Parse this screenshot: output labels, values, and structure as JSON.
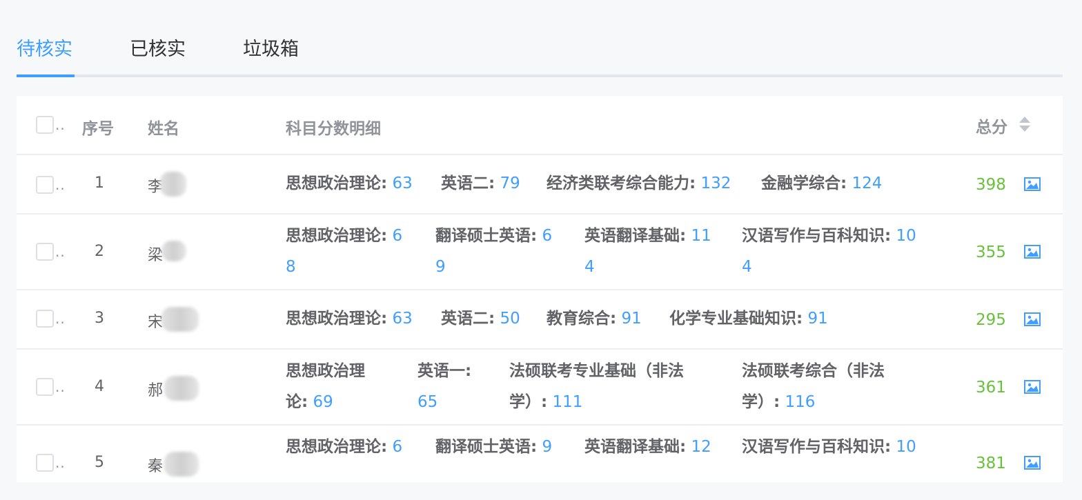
{
  "tabs": [
    {
      "label": "待核实",
      "active": true
    },
    {
      "label": "已核实",
      "active": false
    },
    {
      "label": "垃圾箱",
      "active": false
    }
  ],
  "table": {
    "headers": {
      "select_ellipsis": "..",
      "seq": "序号",
      "name": "姓名",
      "subjects": "科目分数明细",
      "total": "总分"
    },
    "rows": [
      {
        "seq": "1",
        "name": "李",
        "total": "398",
        "subjects": [
          {
            "label": "思想政治理论:",
            "score": "63"
          },
          {
            "label": "英语二:",
            "score": "79"
          },
          {
            "label": "经济类联考综合能力:",
            "score": "132"
          },
          {
            "label": "金融学综合:",
            "score": "124"
          }
        ]
      },
      {
        "seq": "2",
        "name": "梁",
        "total": "355",
        "subjects": [
          {
            "label": "思想政治理论:",
            "score": "6",
            "score_wrap": "8"
          },
          {
            "label": "翻译硕士英语:",
            "score": "6",
            "score_wrap": "9"
          },
          {
            "label": "英语翻译基础:",
            "score": "11",
            "score_wrap": "4"
          },
          {
            "label": "汉语写作与百科知识:",
            "score": "10",
            "score_wrap": "4"
          }
        ]
      },
      {
        "seq": "3",
        "name": "宋",
        "total": "295",
        "subjects": [
          {
            "label": "思想政治理论:",
            "score": "63"
          },
          {
            "label": "英语二:",
            "score": "50"
          },
          {
            "label": "教育综合:",
            "score": "91"
          },
          {
            "label": "化学专业基础知识:",
            "score": "91"
          }
        ]
      },
      {
        "seq": "4",
        "name": "郝",
        "total": "361",
        "subjects": [
          {
            "label": "思想政治理",
            "label_wrap": "论:",
            "score": "69"
          },
          {
            "label": "英语一:",
            "label_wrap": "",
            "score": "65"
          },
          {
            "label": "法硕联考专业基础（非法",
            "label_wrap": "学）:",
            "score": "111"
          },
          {
            "label": "法硕联考综合（非法",
            "label_wrap": "学）:",
            "score": "116"
          }
        ]
      },
      {
        "seq": "5",
        "name": "秦",
        "total": "381",
        "subjects": [
          {
            "label": "思想政治理论:",
            "score": "6"
          },
          {
            "label": "翻译硕士英语:",
            "score": "9"
          },
          {
            "label": "英语翻译基础:",
            "score": "12"
          },
          {
            "label": "汉语写作与百科知识:",
            "score": "10"
          }
        ]
      }
    ]
  },
  "colors": {
    "accent": "#409eff",
    "total_green": "#67c23a",
    "header_text": "#909399",
    "label_text": "#606266"
  },
  "icons": {
    "sort": "sort-caret-icon",
    "image": "image-icon"
  }
}
